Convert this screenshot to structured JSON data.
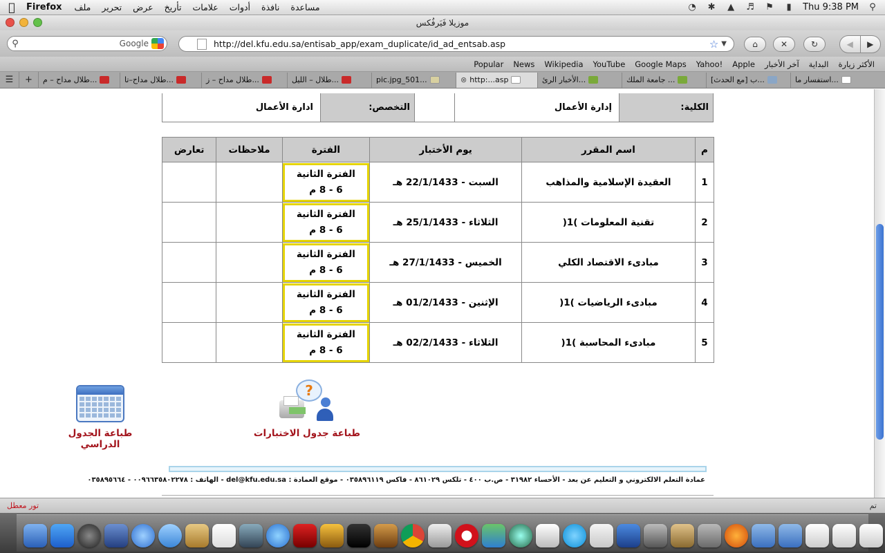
{
  "menubar": {
    "app_name": "Firefox",
    "menus": [
      "ملف",
      "تحرير",
      "عرض",
      "تأريخ",
      "علامات",
      "أدوات",
      "نافذة",
      "مساعدة"
    ],
    "clock": "Thu 9:38 PM"
  },
  "window": {
    "title": "موزيلا فَيَرفُكس"
  },
  "toolbar": {
    "search_placeholder": "Google",
    "url": "http://del.kfu.edu.sa/entisab_app/exam_duplicate/id_ad_entsab.asp"
  },
  "bookmarks": [
    "الأكثر زيارة",
    "البداية",
    "آخر الأخبار",
    "Apple",
    "Yahoo!",
    "Google Maps",
    "YouTube",
    "Wikipedia",
    "News",
    "Popular"
  ],
  "tabs": [
    {
      "label": "طلال مداح – م...",
      "fav": "fav-yt"
    },
    {
      "label": "طلال مداح–تا...",
      "fav": "fav-yt"
    },
    {
      "label": "طلال مداح – ز...",
      "fav": "fav-yt"
    },
    {
      "label": "طلال – الليل...",
      "fav": "fav-yt"
    },
    {
      "label": "pic.jpg_501...",
      "fav": "fav-pic"
    },
    {
      "label": "http:...asp",
      "fav": "fav-doc"
    },
    {
      "label": "الأخبار الرئ...",
      "fav": "fav-kfu"
    },
    {
      "label": "جامعة الملك ...",
      "fav": "fav-kfu"
    },
    {
      "label": "[مع الحدث] ب...",
      "fav": "fav-rss"
    },
    {
      "label": "استفسار ما...",
      "fav": "fav-doc"
    }
  ],
  "student_info": {
    "college_label": "الكلية:",
    "college_value": "إدارة الأعمال",
    "major_label": "التخصص:",
    "major_value": "ادارة الأعمال"
  },
  "exam_table": {
    "headers": [
      "م",
      "اسم المقرر",
      "يوم الأختبار",
      "الفترة",
      "ملاحظات",
      "تعارض"
    ],
    "rows": [
      {
        "num": "1",
        "course": "العقيدة الإسلامية والمذاهب",
        "day": "السبت - 22/1/1433 هـ",
        "period_1": "الفترة الثانية",
        "period_2": "6 - 8 م",
        "notes": "",
        "conflict": ""
      },
      {
        "num": "2",
        "course": "تقنية المعلومات )1(",
        "day": "الثلاثاء - 25/1/1433 هـ",
        "period_1": "الفترة الثانية",
        "period_2": "6 - 8 م",
        "notes": "",
        "conflict": ""
      },
      {
        "num": "3",
        "course": "مبادىء الاقتصاد الكلي",
        "day": "الخميس - 27/1/1433 هـ",
        "period_1": "الفترة الثانية",
        "period_2": "6 - 8 م",
        "notes": "",
        "conflict": ""
      },
      {
        "num": "4",
        "course": "مبادىء الرياضيات )1(",
        "day": "الإثنين - 01/2/1433 هـ",
        "period_1": "الفترة الثانية",
        "period_2": "6 - 8 م",
        "notes": "",
        "conflict": ""
      },
      {
        "num": "5",
        "course": "مبادىء المحاسبة )1(",
        "day": "الثلاثاء - 02/2/1433 هـ",
        "period_1": "الفترة الثانية",
        "period_2": "6 - 8 م",
        "notes": "",
        "conflict": ""
      }
    ]
  },
  "actions": {
    "print_study_schedule": "طباعة الجدول الدراسي",
    "print_exam_schedule": "طباعة جدول الاختبارات"
  },
  "footer": {
    "contact": "عمادة التعلم الالكتروني و التعليم عن بعد - الأحساء ٣١٩٨٢ - ص.ب ٤٠٠ - تلكس ٨٦١٠٢٩ - فاكس ٠٣٥٨٩٦١١٩ - موقع العمادة : del@kfu.edu.sa - الهاتف : ٠٠٩٦٦٣٥٨٠٢٢٧٨ - ٠٣٥٨٩٥٦٦٤"
  },
  "status": {
    "left": "تور معطل",
    "right": "تم"
  },
  "colors": {
    "period_highlight": "#e5d400",
    "print_link": "#a3141c",
    "header_gray": "#cccccc"
  }
}
